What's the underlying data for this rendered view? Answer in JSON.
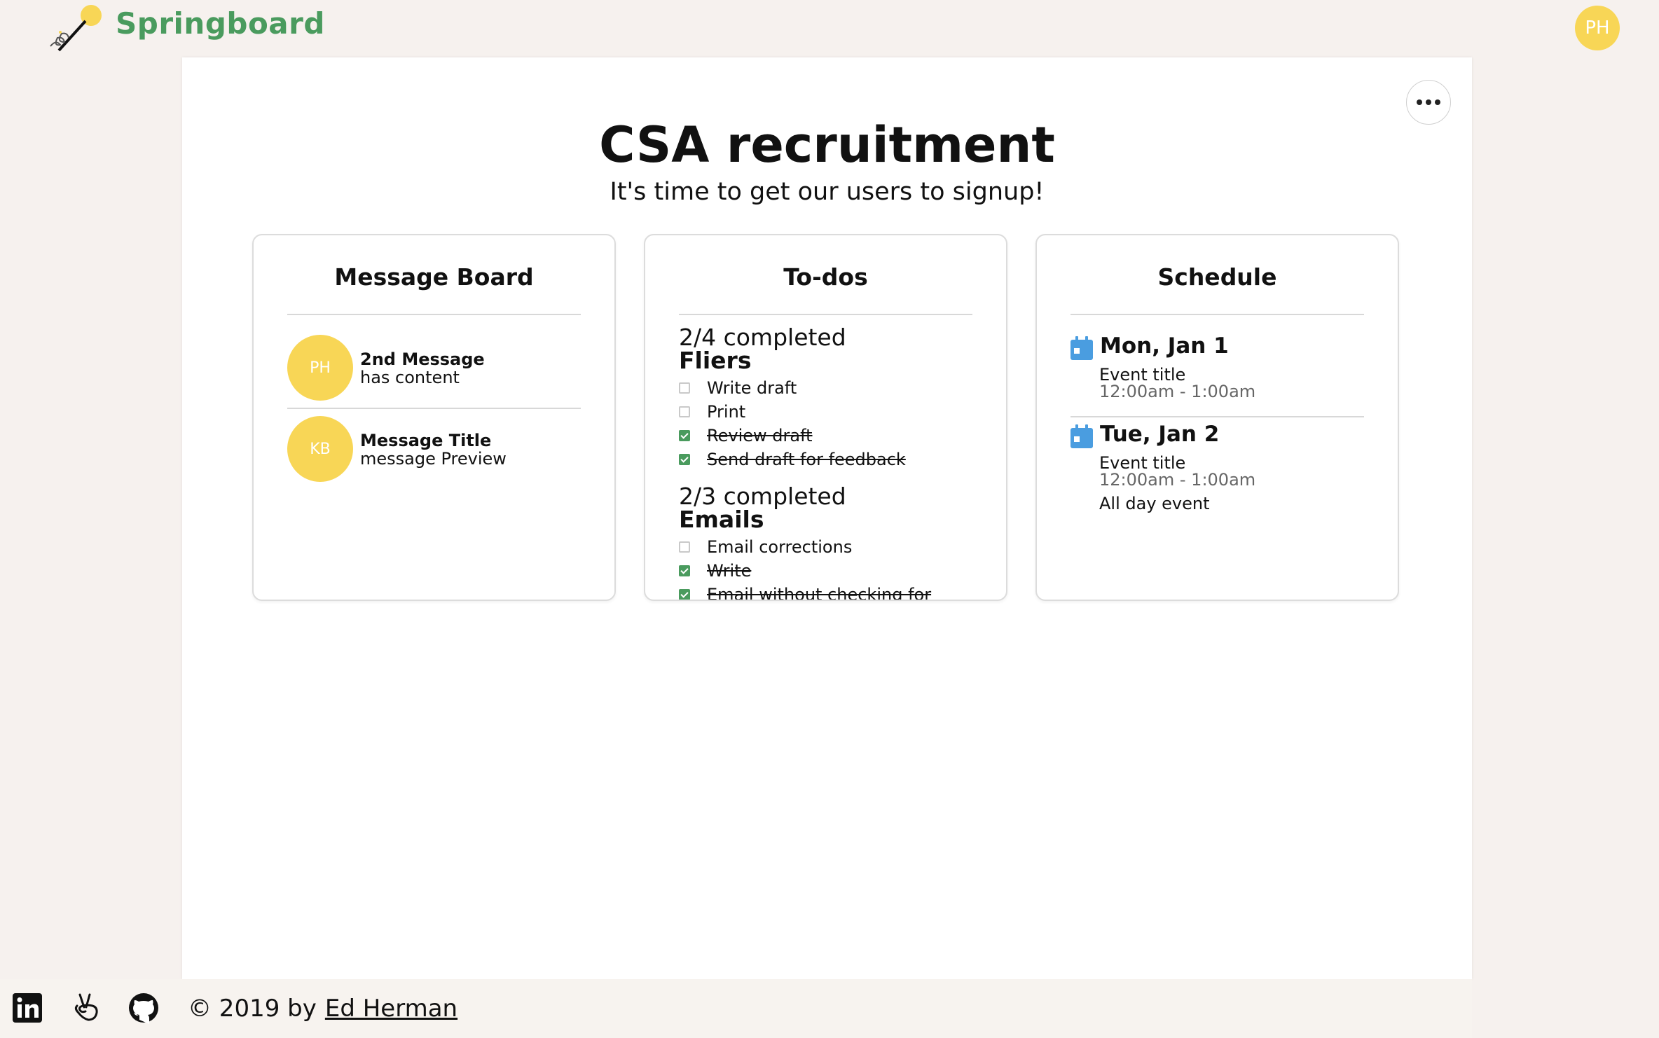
{
  "header": {
    "brand": "Springboard",
    "user_initials": "PH"
  },
  "project": {
    "title": "CSA recruitment",
    "description": "It's time to get our users to signup!"
  },
  "message_board": {
    "title": "Message Board",
    "messages": [
      {
        "initials": "PH",
        "title": "2nd Message",
        "preview": "has content"
      },
      {
        "initials": "KB",
        "title": "Message Title",
        "preview": "message Preview"
      }
    ]
  },
  "todos": {
    "title": "To-dos",
    "lists": [
      {
        "count": "2/4 completed",
        "name": "Fliers",
        "items": [
          {
            "text": "Write draft",
            "done": false
          },
          {
            "text": "Print",
            "done": false
          },
          {
            "text": "Review draft",
            "done": true
          },
          {
            "text": "Send draft for feedback",
            "done": true
          }
        ]
      },
      {
        "count": "2/3 completed",
        "name": "Emails",
        "items": [
          {
            "text": "Email corrections",
            "done": false
          },
          {
            "text": "Write",
            "done": true
          },
          {
            "text": "Email without checking for",
            "done": true
          }
        ]
      }
    ]
  },
  "schedule": {
    "title": "Schedule",
    "events": [
      {
        "date": "Mon, Jan 1",
        "title": "Event title",
        "time": "12:00am - 1:00am",
        "note": ""
      },
      {
        "date": "Tue, Jan 2",
        "title": "Event title",
        "time": "12:00am - 1:00am",
        "note": "All day event"
      }
    ]
  },
  "footer": {
    "copyright": "© 2019 by",
    "author": "Ed Herman",
    "icons": [
      "linkedin-icon",
      "angellist-icon",
      "github-icon"
    ]
  },
  "colors": {
    "page_bg": "#f6f1ee",
    "brand_green": "#4a9b5e",
    "avatar_yellow": "#f8d656",
    "calendar_blue": "#4a9de0"
  }
}
